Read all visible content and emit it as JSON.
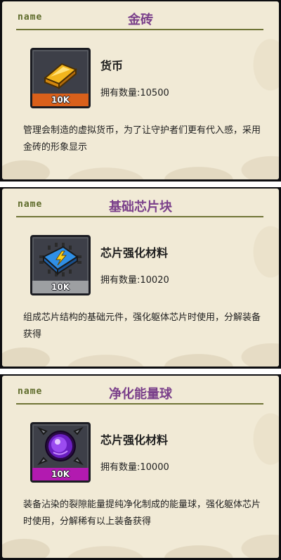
{
  "cards": [
    {
      "name_label": "name",
      "title": "金砖",
      "icon": "gold-bar-icon",
      "badge": "10K",
      "badge_color": "#d9601b",
      "item_type": "货币",
      "quantity": "拥有数量:10500",
      "description": "管理会制造的虚拟货币，为了让守护者们更有代入感，采用金砖的形象显示"
    },
    {
      "name_label": "name",
      "title": "基础芯片块",
      "icon": "chip-block-icon",
      "badge": "10K",
      "badge_color": "#9d9fa2",
      "item_type": "芯片强化材料",
      "quantity": "拥有数量:10020",
      "description": "组成芯片结构的基础元件，强化躯体芯片时使用，分解装备获得"
    },
    {
      "name_label": "name",
      "title": "净化能量球",
      "icon": "energy-orb-icon",
      "badge": "10K",
      "badge_color": "#b21ab0",
      "item_type": "芯片强化材料",
      "quantity": "拥有数量:10000",
      "description": "装备沾染的裂隙能量提纯净化制成的能量球，强化躯体芯片时使用，分解稀有以上装备获得"
    }
  ]
}
